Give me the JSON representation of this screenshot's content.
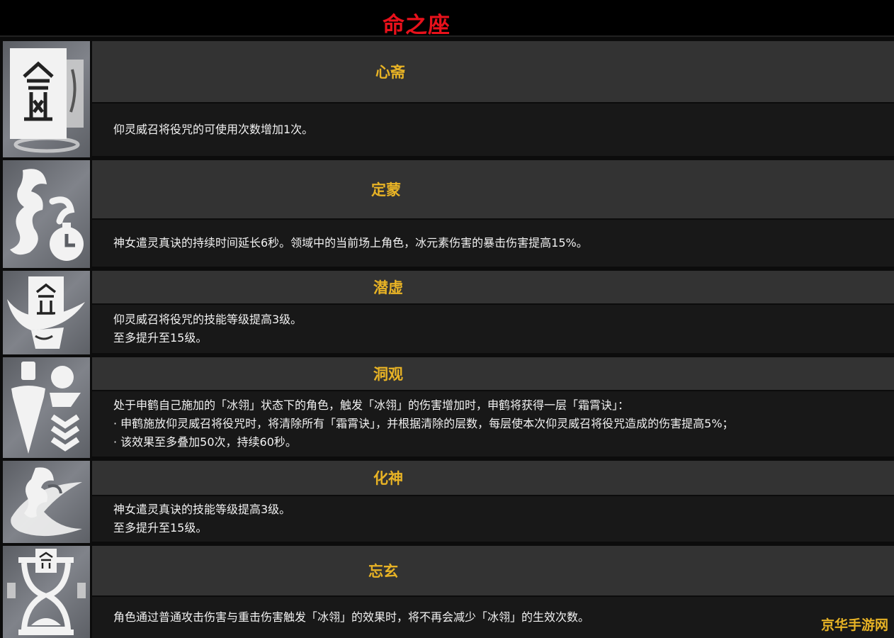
{
  "header": {
    "title": "命之座"
  },
  "constellations": [
    {
      "icon": "scroll-talisman-icon",
      "name": "心斋",
      "lines": [
        "仰灵威召将役咒的可使用次数增加1次。"
      ]
    },
    {
      "icon": "goddess-timer-icon",
      "name": "定蒙",
      "lines": [
        "神女遣灵真诀的持续时间延长6秒。领域中的当前场上角色，冰元素伤害的暴击伤害提高15%。"
      ]
    },
    {
      "icon": "talisman-wave-icon",
      "name": "潜虚",
      "lines": [
        "仰灵威召将役咒的技能等级提高3级。",
        "至多提升至15级。"
      ]
    },
    {
      "icon": "shield-chevron-icon",
      "name": "洞观",
      "lines": [
        "处于申鹤自己施加的「冰翎」状态下的角色，触发「冰翎」的伤害增加时，申鹤将获得一层「霜霄诀」：",
        "· 申鹤施放仰灵威召将役咒时，将清除所有「霜霄诀」，并根据清除的层数，每层使本次仰灵威召将役咒造成的伤害提高5%；",
        "· 该效果至多叠加50次，持续60秒。"
      ]
    },
    {
      "icon": "goddess-swirl-icon",
      "name": "化神",
      "lines": [
        "神女遣灵真诀的技能等级提高3级。",
        "至多提升至15级。"
      ]
    },
    {
      "icon": "hourglass-icon",
      "name": "忘玄",
      "lines": [
        "角色通过普通攻击伤害与重击伤害触发「冰翎」的效果时，将不再会减少「冰翎」的生效次数。"
      ]
    }
  ],
  "watermark": "京华手游网"
}
